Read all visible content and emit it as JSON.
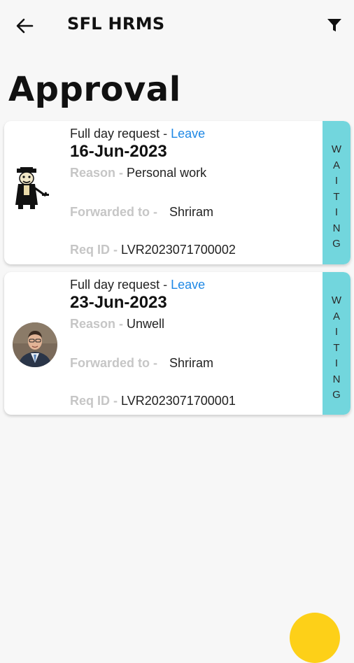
{
  "appbar": {
    "title": "SFL HRMS",
    "back_icon": "arrow-left-icon",
    "filter_icon": "filter-icon"
  },
  "page_title": "Approval",
  "requests": [
    {
      "request_type": "Full day request",
      "separator": " - ",
      "category": "Leave",
      "date": "16-Jun-2023",
      "reason_label": "Reason - ",
      "reason": "Personal work",
      "forwarded_label": "Forwarded to - ",
      "forwarded_to": "Shriram",
      "req_label": "Req ID - ",
      "req_id": "LVR2023071700002",
      "status_letters": [
        "W",
        "A",
        "I",
        "T",
        "I",
        "N",
        "G"
      ],
      "avatar": "cartoon-character"
    },
    {
      "request_type": "Full day request",
      "separator": " - ",
      "category": "Leave",
      "date": "23-Jun-2023",
      "reason_label": "Reason - ",
      "reason": "Unwell",
      "forwarded_label": "Forwarded to - ",
      "forwarded_to": "Shriram",
      "req_label": "Req ID - ",
      "req_id": "LVR2023071700001",
      "status_letters": [
        "W",
        "A",
        "I",
        "T",
        "I",
        "N",
        "G"
      ],
      "avatar": "man-in-suit-photo"
    }
  ],
  "colors": {
    "background": "#f7f7f7",
    "status_waiting": "#72d6dd",
    "leave_link": "#1e88e5",
    "fab": "#fdd018"
  }
}
